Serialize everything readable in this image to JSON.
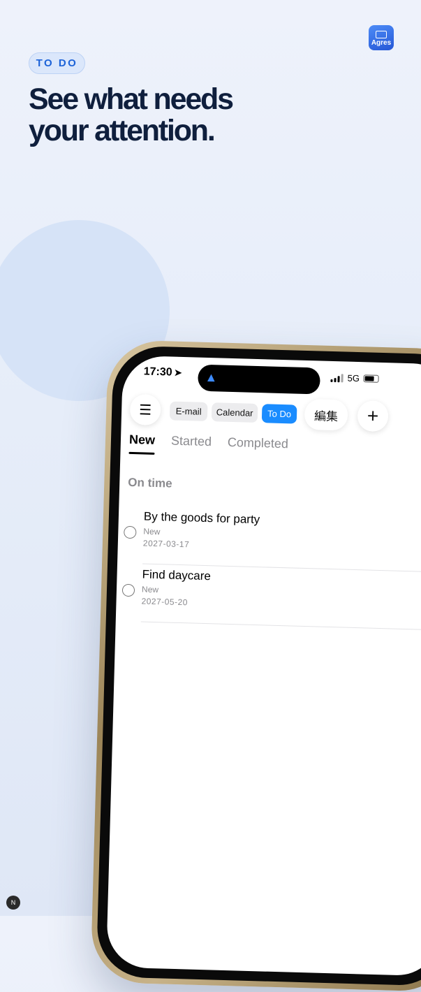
{
  "promo": {
    "badge": "TO DO",
    "headline_line1": "See what needs",
    "headline_line2": "your attention."
  },
  "app_logo": {
    "label": "Agres",
    "icon": "envelope-icon"
  },
  "corner_badge": "N",
  "status_bar": {
    "time": "17:30",
    "network": "5G"
  },
  "toolbar": {
    "menu_icon": "☰",
    "chips": [
      "E-mail",
      "Calendar",
      "To Do"
    ],
    "active_chip": "To Do",
    "edit_label": "編集",
    "add_icon": "+"
  },
  "tabs": [
    "New",
    "Started",
    "Completed"
  ],
  "active_tab": "New",
  "section": {
    "title": "On time"
  },
  "todos": [
    {
      "title": "By the goods for party",
      "status": "New",
      "date": "2027-03-17"
    },
    {
      "title": "Find daycare",
      "status": "New",
      "date": "2027-05-20"
    }
  ],
  "colors": {
    "accent": "#1a8cff",
    "headline": "#0f1f3d",
    "badge_text": "#1d63d8",
    "badge_bg": "#dbe7fb"
  }
}
